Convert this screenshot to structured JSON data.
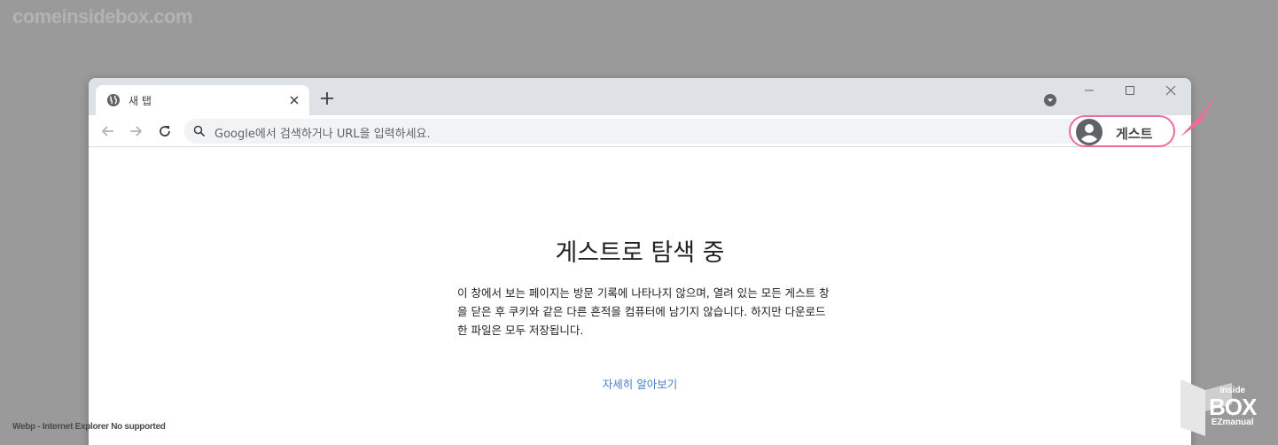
{
  "watermark": {
    "site": "comeinsidebox.com",
    "note": "Webp - Internet Explorer No supported",
    "logo_line1": "inside",
    "logo_line2": "BOX",
    "logo_line3": "EZmanual"
  },
  "tab": {
    "title": "새 탭",
    "icon": "globe-icon"
  },
  "omnibox": {
    "placeholder": "Google에서 검색하거나 URL을 입력하세요."
  },
  "profile": {
    "label": "게스트",
    "highlight_color": "#f06b9c"
  },
  "page": {
    "title": "게스트로 탐색 중",
    "description": "이 창에서 보는 페이지는 방문 기록에 나타나지 않으며, 열려 있는 모든 게스트 창을 닫은 후 쿠키와 같은 다른 흔적을 컴퓨터에 남기지 않습니다. 하지만 다운로드한 파일은 모두 저장됩니다.",
    "learn_more": "자세히 알아보기",
    "link_color": "#4a7fc9"
  }
}
